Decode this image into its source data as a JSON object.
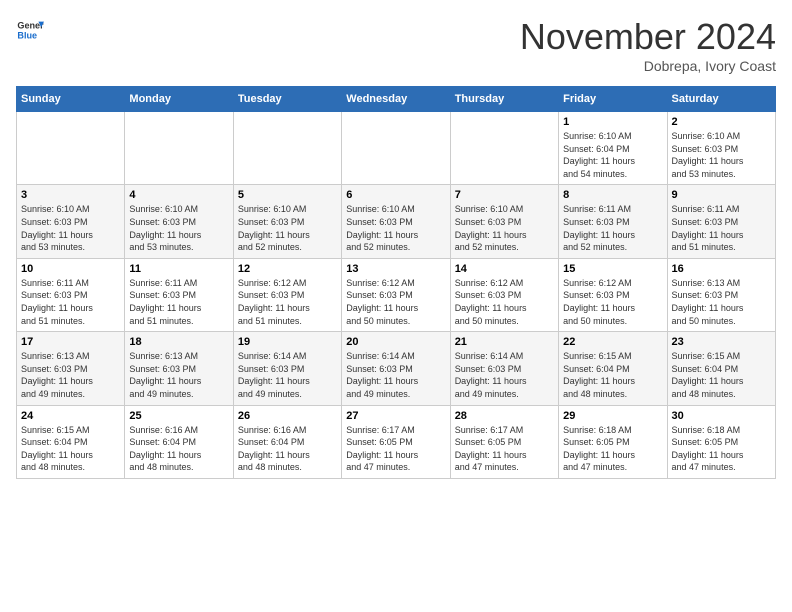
{
  "header": {
    "logo_line1": "General",
    "logo_line2": "Blue",
    "month_title": "November 2024",
    "location": "Dobrepa, Ivory Coast"
  },
  "calendar": {
    "days_of_week": [
      "Sunday",
      "Monday",
      "Tuesday",
      "Wednesday",
      "Thursday",
      "Friday",
      "Saturday"
    ],
    "weeks": [
      [
        {
          "day": "",
          "info": ""
        },
        {
          "day": "",
          "info": ""
        },
        {
          "day": "",
          "info": ""
        },
        {
          "day": "",
          "info": ""
        },
        {
          "day": "",
          "info": ""
        },
        {
          "day": "1",
          "info": "Sunrise: 6:10 AM\nSunset: 6:04 PM\nDaylight: 11 hours\nand 54 minutes."
        },
        {
          "day": "2",
          "info": "Sunrise: 6:10 AM\nSunset: 6:03 PM\nDaylight: 11 hours\nand 53 minutes."
        }
      ],
      [
        {
          "day": "3",
          "info": "Sunrise: 6:10 AM\nSunset: 6:03 PM\nDaylight: 11 hours\nand 53 minutes."
        },
        {
          "day": "4",
          "info": "Sunrise: 6:10 AM\nSunset: 6:03 PM\nDaylight: 11 hours\nand 53 minutes."
        },
        {
          "day": "5",
          "info": "Sunrise: 6:10 AM\nSunset: 6:03 PM\nDaylight: 11 hours\nand 52 minutes."
        },
        {
          "day": "6",
          "info": "Sunrise: 6:10 AM\nSunset: 6:03 PM\nDaylight: 11 hours\nand 52 minutes."
        },
        {
          "day": "7",
          "info": "Sunrise: 6:10 AM\nSunset: 6:03 PM\nDaylight: 11 hours\nand 52 minutes."
        },
        {
          "day": "8",
          "info": "Sunrise: 6:11 AM\nSunset: 6:03 PM\nDaylight: 11 hours\nand 52 minutes."
        },
        {
          "day": "9",
          "info": "Sunrise: 6:11 AM\nSunset: 6:03 PM\nDaylight: 11 hours\nand 51 minutes."
        }
      ],
      [
        {
          "day": "10",
          "info": "Sunrise: 6:11 AM\nSunset: 6:03 PM\nDaylight: 11 hours\nand 51 minutes."
        },
        {
          "day": "11",
          "info": "Sunrise: 6:11 AM\nSunset: 6:03 PM\nDaylight: 11 hours\nand 51 minutes."
        },
        {
          "day": "12",
          "info": "Sunrise: 6:12 AM\nSunset: 6:03 PM\nDaylight: 11 hours\nand 51 minutes."
        },
        {
          "day": "13",
          "info": "Sunrise: 6:12 AM\nSunset: 6:03 PM\nDaylight: 11 hours\nand 50 minutes."
        },
        {
          "day": "14",
          "info": "Sunrise: 6:12 AM\nSunset: 6:03 PM\nDaylight: 11 hours\nand 50 minutes."
        },
        {
          "day": "15",
          "info": "Sunrise: 6:12 AM\nSunset: 6:03 PM\nDaylight: 11 hours\nand 50 minutes."
        },
        {
          "day": "16",
          "info": "Sunrise: 6:13 AM\nSunset: 6:03 PM\nDaylight: 11 hours\nand 50 minutes."
        }
      ],
      [
        {
          "day": "17",
          "info": "Sunrise: 6:13 AM\nSunset: 6:03 PM\nDaylight: 11 hours\nand 49 minutes."
        },
        {
          "day": "18",
          "info": "Sunrise: 6:13 AM\nSunset: 6:03 PM\nDaylight: 11 hours\nand 49 minutes."
        },
        {
          "day": "19",
          "info": "Sunrise: 6:14 AM\nSunset: 6:03 PM\nDaylight: 11 hours\nand 49 minutes."
        },
        {
          "day": "20",
          "info": "Sunrise: 6:14 AM\nSunset: 6:03 PM\nDaylight: 11 hours\nand 49 minutes."
        },
        {
          "day": "21",
          "info": "Sunrise: 6:14 AM\nSunset: 6:03 PM\nDaylight: 11 hours\nand 49 minutes."
        },
        {
          "day": "22",
          "info": "Sunrise: 6:15 AM\nSunset: 6:04 PM\nDaylight: 11 hours\nand 48 minutes."
        },
        {
          "day": "23",
          "info": "Sunrise: 6:15 AM\nSunset: 6:04 PM\nDaylight: 11 hours\nand 48 minutes."
        }
      ],
      [
        {
          "day": "24",
          "info": "Sunrise: 6:15 AM\nSunset: 6:04 PM\nDaylight: 11 hours\nand 48 minutes."
        },
        {
          "day": "25",
          "info": "Sunrise: 6:16 AM\nSunset: 6:04 PM\nDaylight: 11 hours\nand 48 minutes."
        },
        {
          "day": "26",
          "info": "Sunrise: 6:16 AM\nSunset: 6:04 PM\nDaylight: 11 hours\nand 48 minutes."
        },
        {
          "day": "27",
          "info": "Sunrise: 6:17 AM\nSunset: 6:05 PM\nDaylight: 11 hours\nand 47 minutes."
        },
        {
          "day": "28",
          "info": "Sunrise: 6:17 AM\nSunset: 6:05 PM\nDaylight: 11 hours\nand 47 minutes."
        },
        {
          "day": "29",
          "info": "Sunrise: 6:18 AM\nSunset: 6:05 PM\nDaylight: 11 hours\nand 47 minutes."
        },
        {
          "day": "30",
          "info": "Sunrise: 6:18 AM\nSunset: 6:05 PM\nDaylight: 11 hours\nand 47 minutes."
        }
      ]
    ]
  }
}
